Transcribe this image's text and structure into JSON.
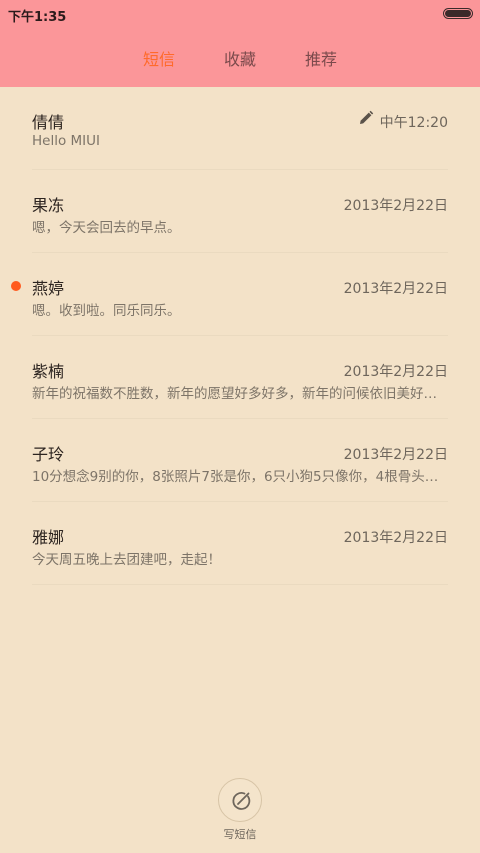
{
  "status_bar": {
    "time": "下午1:35"
  },
  "tabs": [
    {
      "label": "短信",
      "active": true
    },
    {
      "label": "收藏",
      "active": false
    },
    {
      "label": "推荐",
      "active": false
    }
  ],
  "conversations": [
    {
      "name": "倩倩",
      "snippet": "Hello MIUI",
      "time": "中午12:20",
      "draft": true,
      "unread": false
    },
    {
      "name": "果冻",
      "snippet": "嗯，今天会回去的早点。",
      "time": "2013年2月22日",
      "draft": false,
      "unread": false
    },
    {
      "name": "燕婷",
      "snippet": "嗯。收到啦。同乐同乐。",
      "time": "2013年2月22日",
      "draft": false,
      "unread": true
    },
    {
      "name": "紫楠",
      "snippet": "新年的祝福数不胜数，新年的愿望好多好多，新年的问候依旧美好…",
      "time": "2013年2月22日",
      "draft": false,
      "unread": false
    },
    {
      "name": "子玲",
      "snippet": "10分想念9别的你，8张照片7张是你，6只小狗5只像你，4根骨头…",
      "time": "2013年2月22日",
      "draft": false,
      "unread": false
    },
    {
      "name": "雅娜",
      "snippet": "今天周五晚上去团建吧，走起！",
      "time": "2013年2月22日",
      "draft": false,
      "unread": false
    }
  ],
  "compose": {
    "label": "写短信",
    "icon": "compose-icon"
  },
  "colors": {
    "header": "#fb9699",
    "background": "#f3e2c8",
    "accent": "#ff6a2b",
    "unread": "#ff5a1e"
  }
}
